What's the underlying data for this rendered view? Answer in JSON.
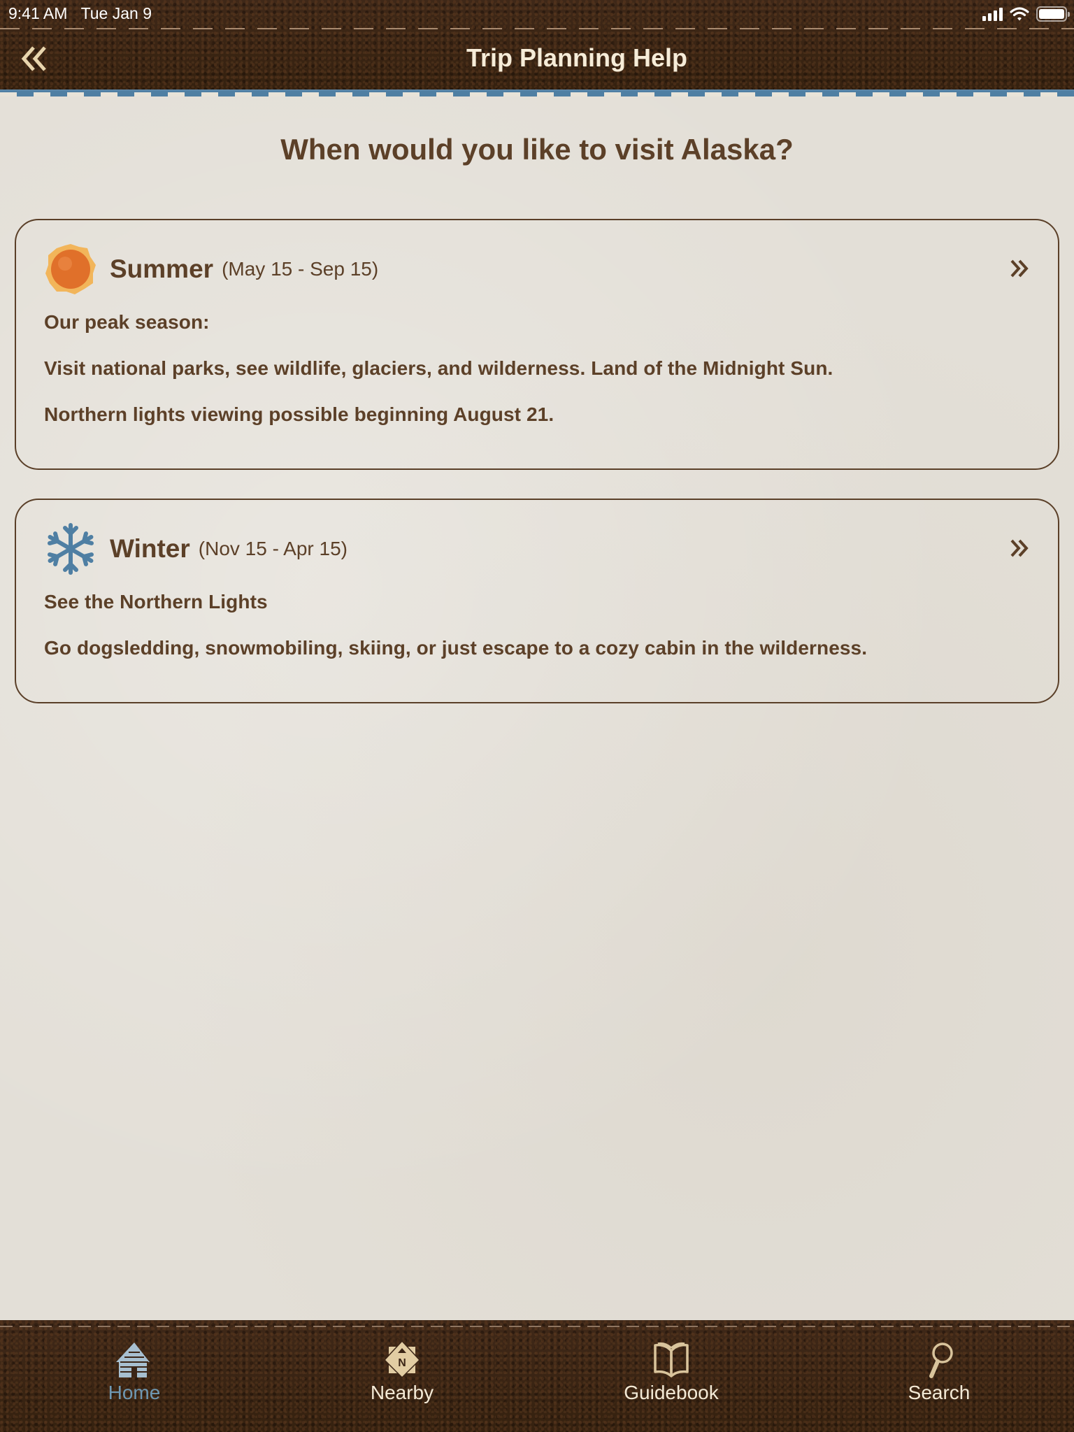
{
  "status_bar": {
    "time": "9:41 AM",
    "date": "Tue Jan 9",
    "icons": [
      "cellular-signal-icon",
      "wifi-icon",
      "battery-icon"
    ]
  },
  "nav": {
    "back_icon": "double-chevron-left-icon",
    "title": "Trip Planning Help"
  },
  "main": {
    "heading": "When would you like to visit Alaska?",
    "seasons": [
      {
        "icon": "sun-icon",
        "name": "Summer",
        "range": "(May 15 - Sep 15)",
        "lines": [
          "Our peak season:",
          "Visit national parks, see wildlife, glaciers, and wilderness. Land of the Midnight Sun.",
          "Northern lights viewing possible beginning August 21."
        ],
        "chevron_icon": "double-chevron-right-icon"
      },
      {
        "icon": "snowflake-icon",
        "name": "Winter",
        "range": "(Nov 15 - Apr 15)",
        "lines": [
          "See the Northern Lights",
          "Go dogsledding, snowmobiling, skiing, or just escape to a cozy cabin in the wilderness."
        ],
        "chevron_icon": "double-chevron-right-icon"
      }
    ]
  },
  "tabbar": {
    "active": "Home",
    "tabs": [
      {
        "label": "Home",
        "icon": "cabin-icon"
      },
      {
        "label": "Nearby",
        "icon": "compass-north-icon"
      },
      {
        "label": "Guidebook",
        "icon": "open-book-icon"
      },
      {
        "label": "Search",
        "icon": "magnifier-icon"
      }
    ]
  },
  "colors": {
    "text_brown": "#5c4028",
    "leather": "#3b2516",
    "accent_blue": "#4f7fa3",
    "active_tab": "#6f98b3",
    "sun_orange": "#e0702a",
    "sun_yellow": "#f2b55a",
    "cream": "#f6ecd8"
  }
}
